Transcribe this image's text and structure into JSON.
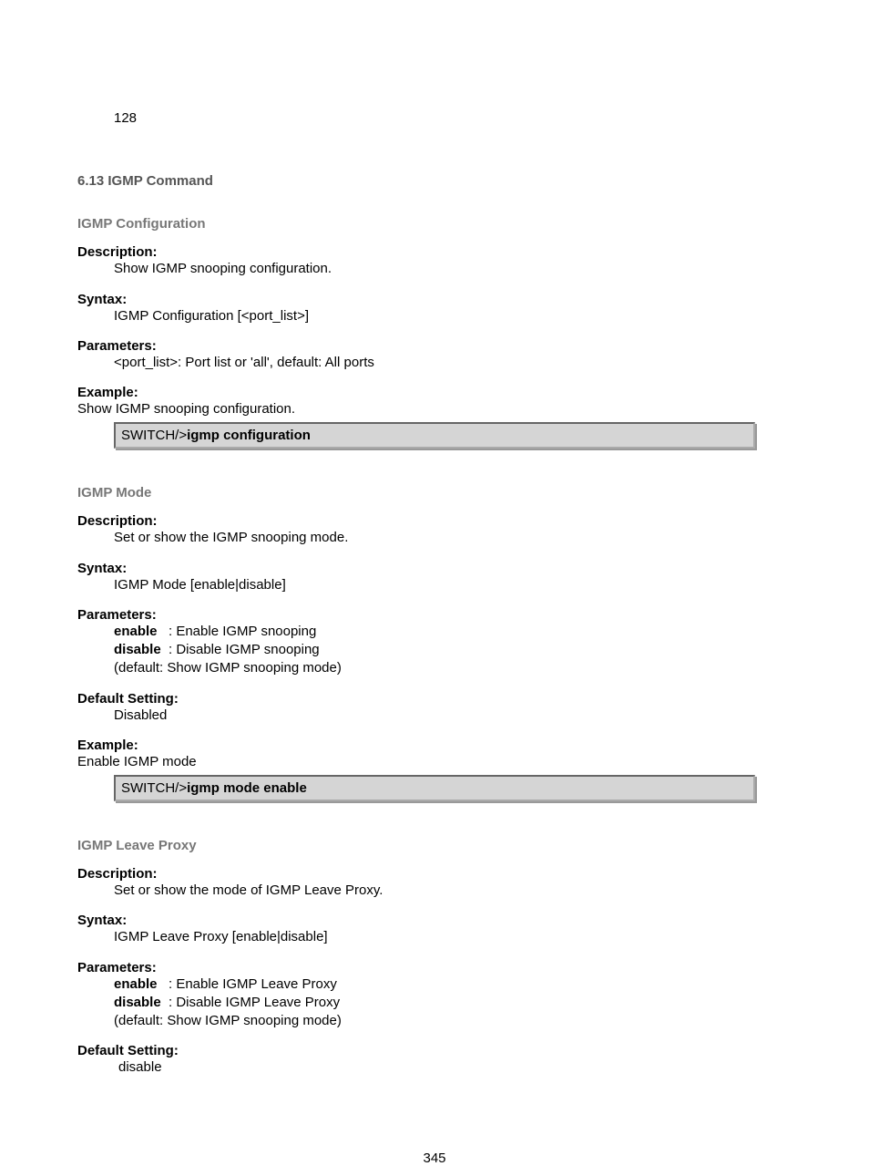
{
  "top_value": "128",
  "heading": "6.13 IGMP Command",
  "config": {
    "title": "IGMP Configuration",
    "desc_label": "Description:",
    "desc": "Show IGMP snooping configuration.",
    "syntax_label": "Syntax:",
    "syntax": "IGMP Configuration [<port_list>]",
    "params_label": "Parameters:",
    "params": "<port_list>: Port list or 'all', default: All ports",
    "example_label": "Example:",
    "example_desc": "Show IGMP snooping configuration.",
    "prompt": "SWITCH/>",
    "cmd": "igmp configuration"
  },
  "mode": {
    "title": "IGMP Mode",
    "desc_label": "Description:",
    "desc": "Set or show the IGMP snooping mode.",
    "syntax_label": "Syntax:",
    "syntax": "IGMP Mode [enable|disable]",
    "params_label": "Parameters:",
    "p1k": "enable",
    "p1v": ": Enable IGMP snooping",
    "p2k": "disable",
    "p2v": ": Disable IGMP snooping",
    "p3": "(default: Show IGMP snooping mode)",
    "default_label": "Default Setting:",
    "default": "Disabled",
    "example_label": "Example:",
    "example_desc": "Enable IGMP mode",
    "prompt": "SWITCH/>",
    "cmd": "igmp mode enable"
  },
  "leave": {
    "title": "IGMP Leave Proxy",
    "desc_label": "Description:",
    "desc": "Set or show the mode of IGMP Leave Proxy.",
    "syntax_label": "Syntax:",
    "syntax": "IGMP Leave Proxy [enable|disable]",
    "params_label": "Parameters:",
    "p1k": "enable",
    "p1v": ": Enable IGMP Leave Proxy",
    "p2k": "disable",
    "p2v": ": Disable IGMP Leave Proxy",
    "p3": "(default: Show IGMP snooping mode)",
    "default_label": "Default Setting:",
    "default": "disable"
  },
  "page_number": "345"
}
